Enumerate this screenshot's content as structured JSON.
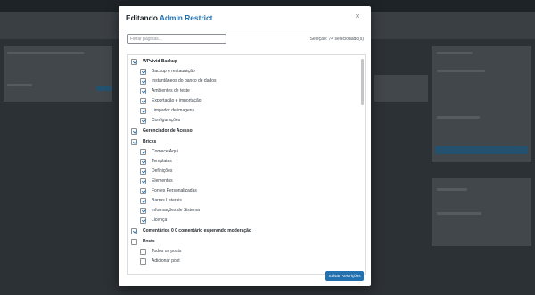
{
  "modal": {
    "title_prefix": "Editando",
    "title_name": "Admin Restrict",
    "close_label": "×",
    "filter_placeholder": "Filtrar páginas...",
    "selection_info": "Seleção: 74 selecionado(s)",
    "save_label": "Salvar Restrições"
  },
  "groups": [
    {
      "label": "WPvivid Backup",
      "checked": true,
      "children": [
        {
          "label": "Backup e restauração",
          "checked": true
        },
        {
          "label": "Instantâneos do banco de dados",
          "checked": true
        },
        {
          "label": "Ambientes de teste",
          "checked": true
        },
        {
          "label": "Exportação e importação",
          "checked": true
        },
        {
          "label": "Limpador de imagens",
          "checked": true
        },
        {
          "label": "Configurações",
          "checked": true
        }
      ]
    },
    {
      "label": "Gerenciador de Acesso",
      "checked": true,
      "children": []
    },
    {
      "label": "Bricks",
      "checked": true,
      "children": [
        {
          "label": "Comece Aqui",
          "checked": true
        },
        {
          "label": "Templates",
          "checked": true
        },
        {
          "label": "Definições",
          "checked": true
        },
        {
          "label": "Elementos",
          "checked": true
        },
        {
          "label": "Fontes Personalizadas",
          "checked": true
        },
        {
          "label": "Barras Laterais",
          "checked": true
        },
        {
          "label": "Informações de Sistema",
          "checked": true
        },
        {
          "label": "Licença",
          "checked": true
        }
      ]
    },
    {
      "label": "Comentários 0 0 comentário esperando moderação",
      "checked": true,
      "children": []
    },
    {
      "label": "Posts",
      "checked": false,
      "children": [
        {
          "label": "Todos os posts",
          "checked": false
        },
        {
          "label": "Adicionar post",
          "checked": false
        }
      ]
    }
  ]
}
